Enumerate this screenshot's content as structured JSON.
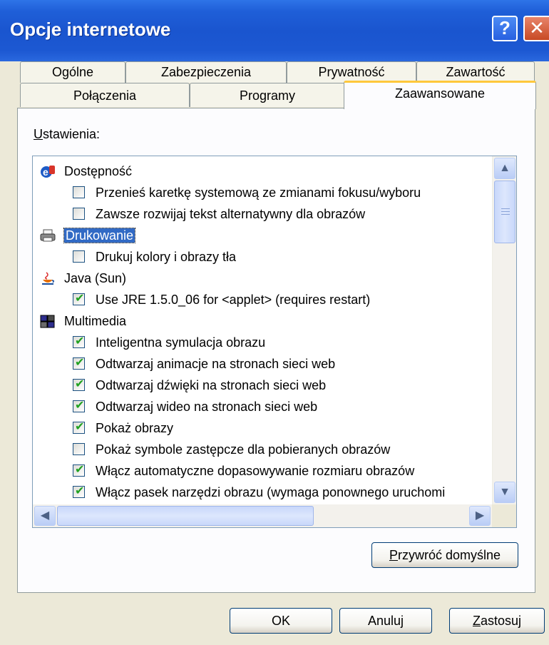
{
  "window": {
    "title": "Opcje internetowe",
    "help_glyph": "?",
    "close_glyph": "✕"
  },
  "tabs": {
    "row1": [
      "Ogólne",
      "Zabezpieczenia",
      "Prywatność",
      "Zawartość"
    ],
    "row2": [
      "Połączenia",
      "Programy",
      "Zaawansowane"
    ],
    "active": "Zaawansowane"
  },
  "panel": {
    "settings_label_u": "U",
    "settings_label_rest": "stawienia:"
  },
  "tree": [
    {
      "type": "category",
      "icon": "accessibility-icon",
      "label": "Dostępność"
    },
    {
      "type": "option",
      "checked": false,
      "label": "Przenieś karetkę systemową ze zmianami fokusu/wyboru"
    },
    {
      "type": "option",
      "checked": false,
      "label": "Zawsze rozwijaj tekst alternatywny dla obrazów"
    },
    {
      "type": "category",
      "icon": "printer-icon",
      "label": "Drukowanie",
      "selected": true
    },
    {
      "type": "option",
      "checked": false,
      "label": "Drukuj kolory i obrazy tła"
    },
    {
      "type": "category",
      "icon": "java-icon",
      "label": "Java (Sun)"
    },
    {
      "type": "option",
      "checked": true,
      "label": "Use JRE 1.5.0_06 for <applet> (requires restart)"
    },
    {
      "type": "category",
      "icon": "multimedia-icon",
      "label": "Multimedia"
    },
    {
      "type": "option",
      "checked": true,
      "label": "Inteligentna symulacja obrazu"
    },
    {
      "type": "option",
      "checked": true,
      "label": "Odtwarzaj animacje na stronach sieci web"
    },
    {
      "type": "option",
      "checked": true,
      "label": "Odtwarzaj dźwięki na stronach sieci web"
    },
    {
      "type": "option",
      "checked": true,
      "label": "Odtwarzaj wideo na stronach sieci web"
    },
    {
      "type": "option",
      "checked": true,
      "label": "Pokaż obrazy"
    },
    {
      "type": "option",
      "checked": false,
      "label": "Pokaż symbole zastępcze dla pobieranych obrazów"
    },
    {
      "type": "option",
      "checked": true,
      "label": "Włącz automatyczne dopasowywanie rozmiaru obrazów"
    },
    {
      "type": "option",
      "checked": true,
      "label": "Włącz pasek narzędzi obrazu (wymaga ponownego uruchomi"
    }
  ],
  "buttons": {
    "restore_u": "P",
    "restore_rest": "rzywróć domyślne",
    "ok": "OK",
    "cancel": "Anuluj",
    "apply_u": "Z",
    "apply_rest": "astosuj"
  },
  "scroll": {
    "up_glyph": "▲",
    "down_glyph": "▼",
    "left_glyph": "◀",
    "right_glyph": "▶",
    "check_glyph": "✔"
  }
}
